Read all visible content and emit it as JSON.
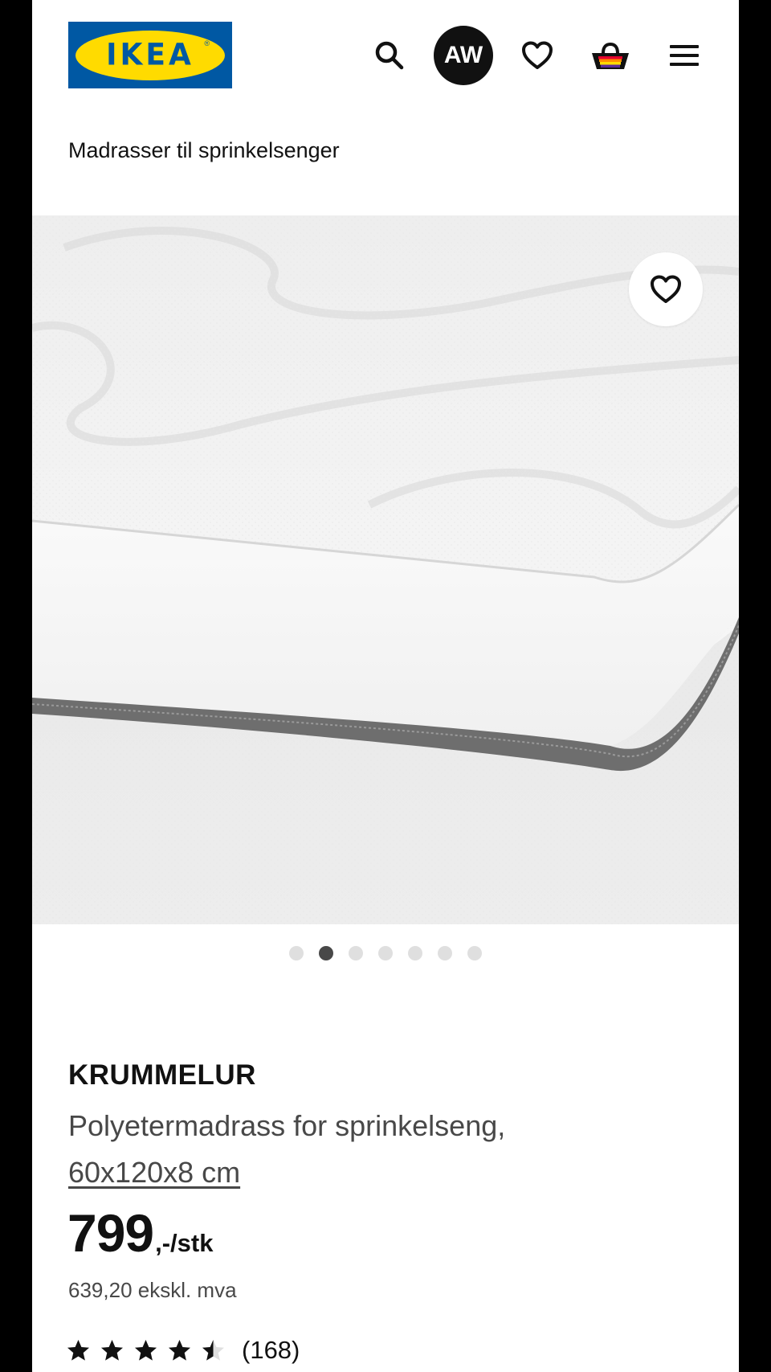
{
  "header": {
    "logo_text": "IKEA",
    "avatar_initials": "AW",
    "icons": [
      "search-icon",
      "heart-icon",
      "basket-icon",
      "hamburger-menu-icon"
    ],
    "brand_colors": {
      "blue": "#0058a3",
      "yellow": "#ffdb00"
    }
  },
  "breadcrumb": "Madrasser til sprinkelsenger",
  "gallery": {
    "image_count": 7,
    "active_index": 1
  },
  "product": {
    "name": "KRUMMELUR",
    "description": "Polyetermadrass for sprinkelseng,",
    "size": "60x120x8 cm",
    "price": "799",
    "price_suffix": ",-/stk",
    "price_ex_vat": "639,20 ekskl. mva",
    "rating": 4.5,
    "review_count": "(168)"
  }
}
